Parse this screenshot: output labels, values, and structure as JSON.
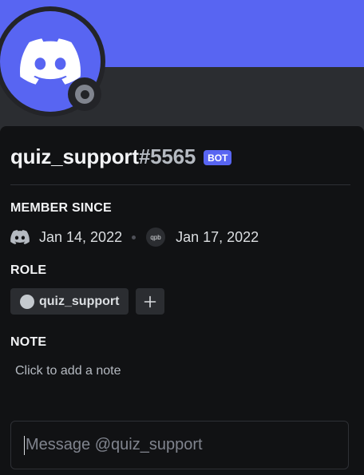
{
  "profile": {
    "username": "quiz_support",
    "discriminator": "#5565",
    "badge": "BOT",
    "status": "offline"
  },
  "member_since": {
    "title": "MEMBER SINCE",
    "discord_icon": "discord-logo-icon",
    "discord_date": "Jan 14, 2022",
    "server_icon_text": "qpb",
    "server_date": "Jan 17, 2022"
  },
  "role": {
    "title": "ROLE",
    "items": [
      {
        "label": "quiz_support",
        "color": "#c4c9ce"
      }
    ],
    "add_icon": "plus-icon"
  },
  "note": {
    "title": "NOTE",
    "placeholder": "Click to add a note"
  },
  "message": {
    "placeholder": "Message @quiz_support"
  },
  "colors": {
    "banner": "#5865f2",
    "bot_badge": "#5865f2",
    "status_offline": "#80848e"
  }
}
